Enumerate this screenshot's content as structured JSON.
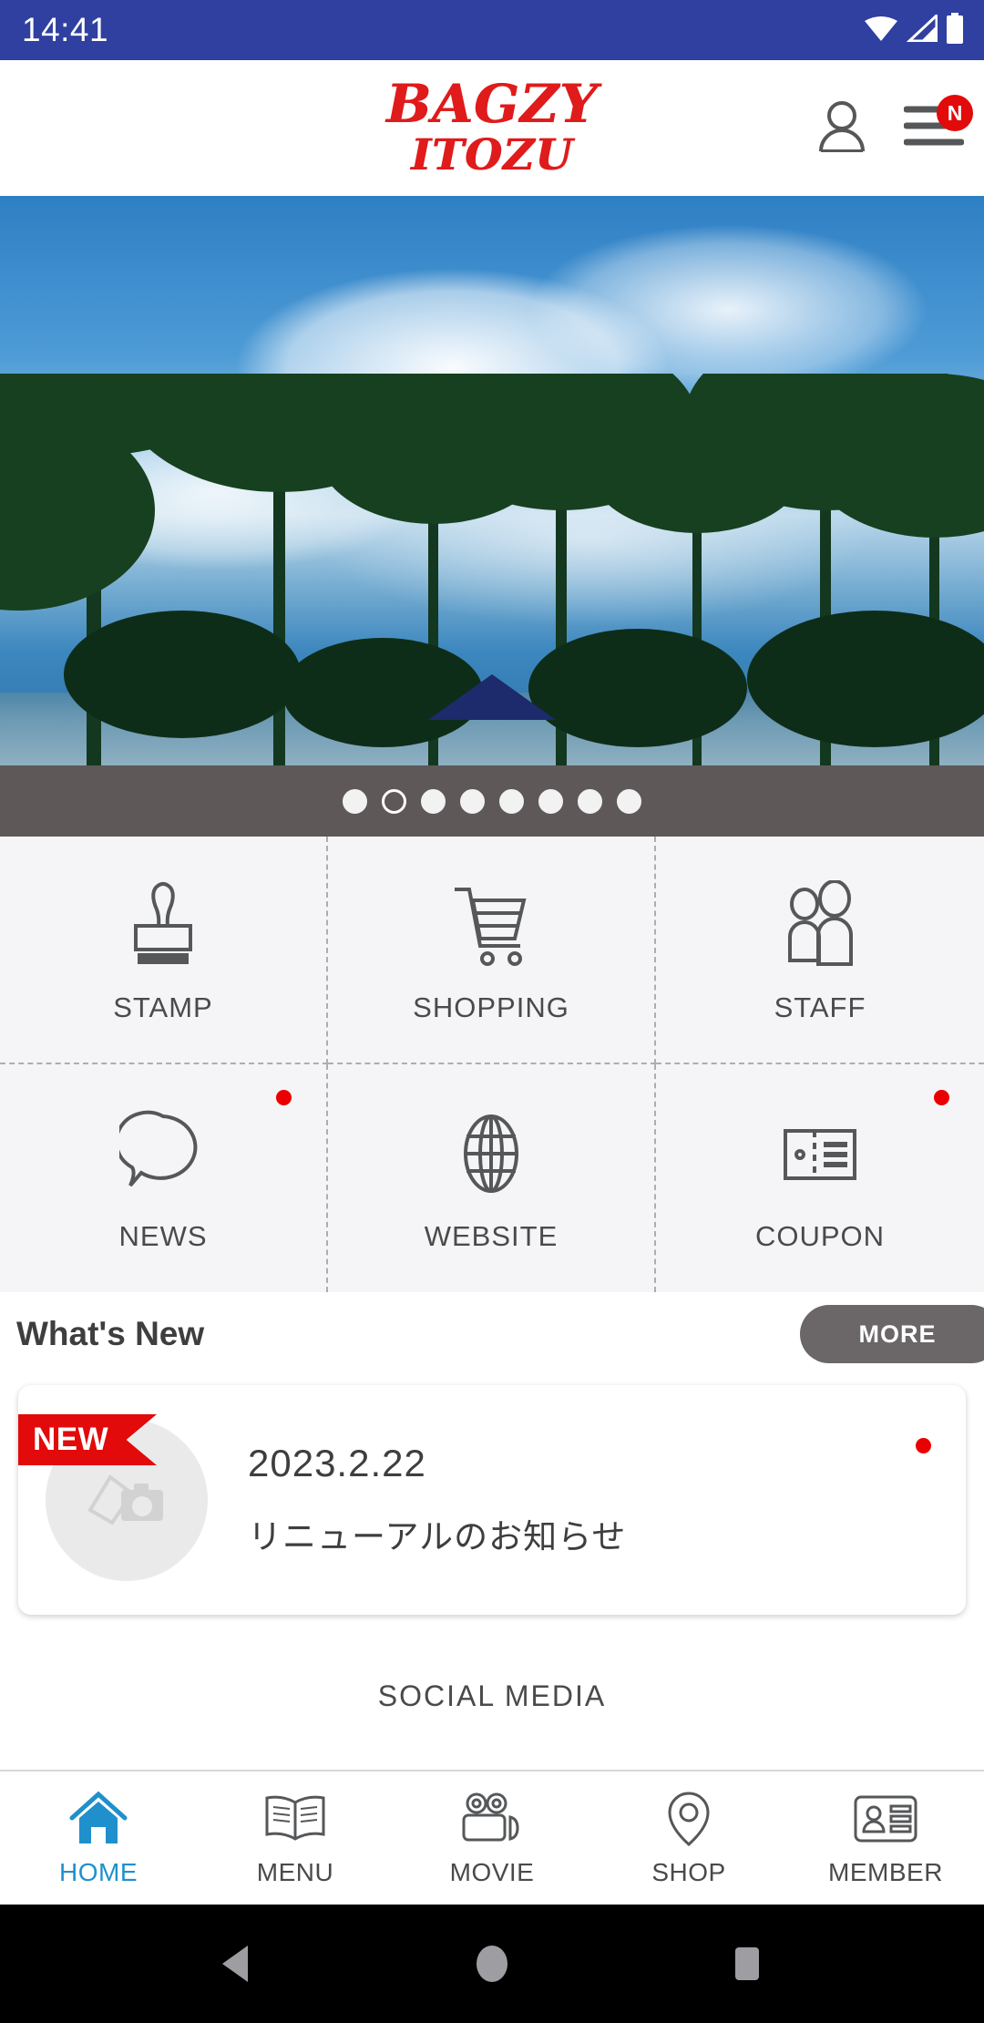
{
  "status_bar": {
    "time": "14:41",
    "background": "#2F40A0",
    "icons": [
      "wifi-icon",
      "cellular-signal-icon",
      "battery-icon"
    ]
  },
  "header": {
    "logo_line1": "BAGZY",
    "logo_line2": "ITOZU",
    "logo_color": "#E01B1B",
    "account_icon": "person-icon",
    "menu_icon": "hamburger-menu-icon",
    "menu_badge": "N",
    "badge_color": "#E20A0A"
  },
  "carousel": {
    "slide_count": 8,
    "active_index": 1,
    "bar_background": "#5E5859",
    "image_alt": "palm trees against blue sky with clouds"
  },
  "grid": {
    "items": [
      {
        "label": "STAMP",
        "icon": "stamp-icon",
        "badge": false
      },
      {
        "label": "SHOPPING",
        "icon": "shopping-cart-icon",
        "badge": false
      },
      {
        "label": "STAFF",
        "icon": "staff-people-icon",
        "badge": false
      },
      {
        "label": "NEWS",
        "icon": "speech-bubble-icon",
        "badge": true
      },
      {
        "label": "WEBSITE",
        "icon": "globe-icon",
        "badge": true
      },
      {
        "label": "COUPON",
        "icon": "coupon-ticket-icon",
        "badge": true
      }
    ],
    "badge_color": "#EA0000"
  },
  "whats_new": {
    "title": "What's New",
    "more_label": "MORE",
    "more_bg": "#6B6668",
    "items": [
      {
        "ribbon": "NEW",
        "ribbon_color": "#E20A0A",
        "date": "2023.2.22",
        "text": "リニューアルのお知らせ",
        "thumb_icon": "photo-placeholder-icon",
        "unread": true
      }
    ]
  },
  "social_media": {
    "title": "SOCIAL MEDIA"
  },
  "tab_bar": {
    "active_color": "#1F90CC",
    "items": [
      {
        "label": "HOME",
        "icon": "home-icon",
        "active": true
      },
      {
        "label": "MENU",
        "icon": "open-book-icon",
        "active": false
      },
      {
        "label": "MOVIE",
        "icon": "video-camera-icon",
        "active": false
      },
      {
        "label": "SHOP",
        "icon": "map-pin-icon",
        "active": false
      },
      {
        "label": "MEMBER",
        "icon": "id-card-icon",
        "active": false
      }
    ]
  },
  "android_nav": {
    "buttons": [
      "back-triangle-icon",
      "home-circle-icon",
      "recents-square-icon"
    ]
  }
}
